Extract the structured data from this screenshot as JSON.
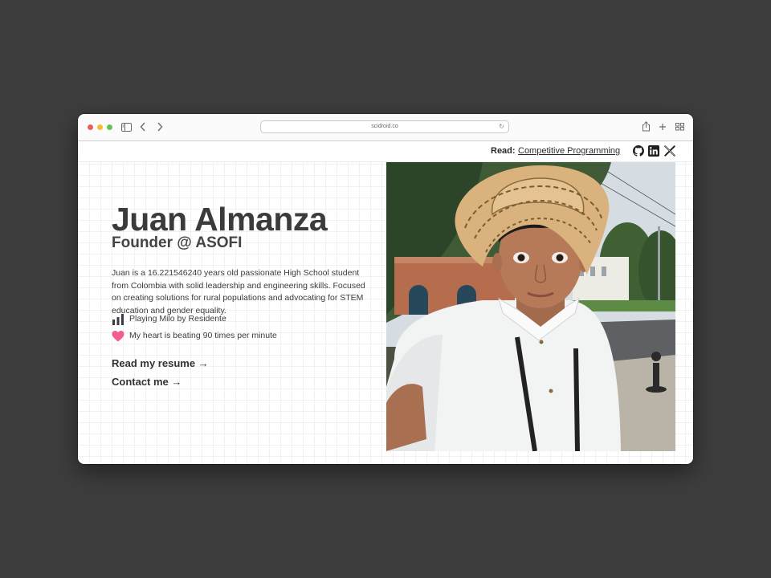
{
  "browser": {
    "url": "scidroid.co",
    "traffic_lights": [
      "#ec5f57",
      "#f5be2e",
      "#61c354"
    ]
  },
  "nav": {
    "read_label": "Read:",
    "read_link": "Competitive Programming",
    "social_icons": [
      "github-icon",
      "linkedin-icon",
      "x-icon"
    ]
  },
  "hero": {
    "name": "Juan Almanza",
    "role": "Founder @ ASOFI",
    "bio": "Juan is a 16.221546240 years old passionate High School student from Colombia with solid leadership and engineering skills. Focused on creating solutions for rural populations and advocating for STEM education and gender equality.",
    "status": [
      {
        "icon": "music-bars-icon",
        "text": "Playing Milo by Residente"
      },
      {
        "icon": "heart-icon",
        "text": "My heart is beating 90 times per minute"
      }
    ],
    "cta": [
      {
        "label": "Read my resume →"
      },
      {
        "label": "Contact me →"
      }
    ]
  },
  "colors": {
    "desktop_bg": "#3d3d3d",
    "heart": "#f0608f",
    "text_dark": "#3b3b3b"
  }
}
